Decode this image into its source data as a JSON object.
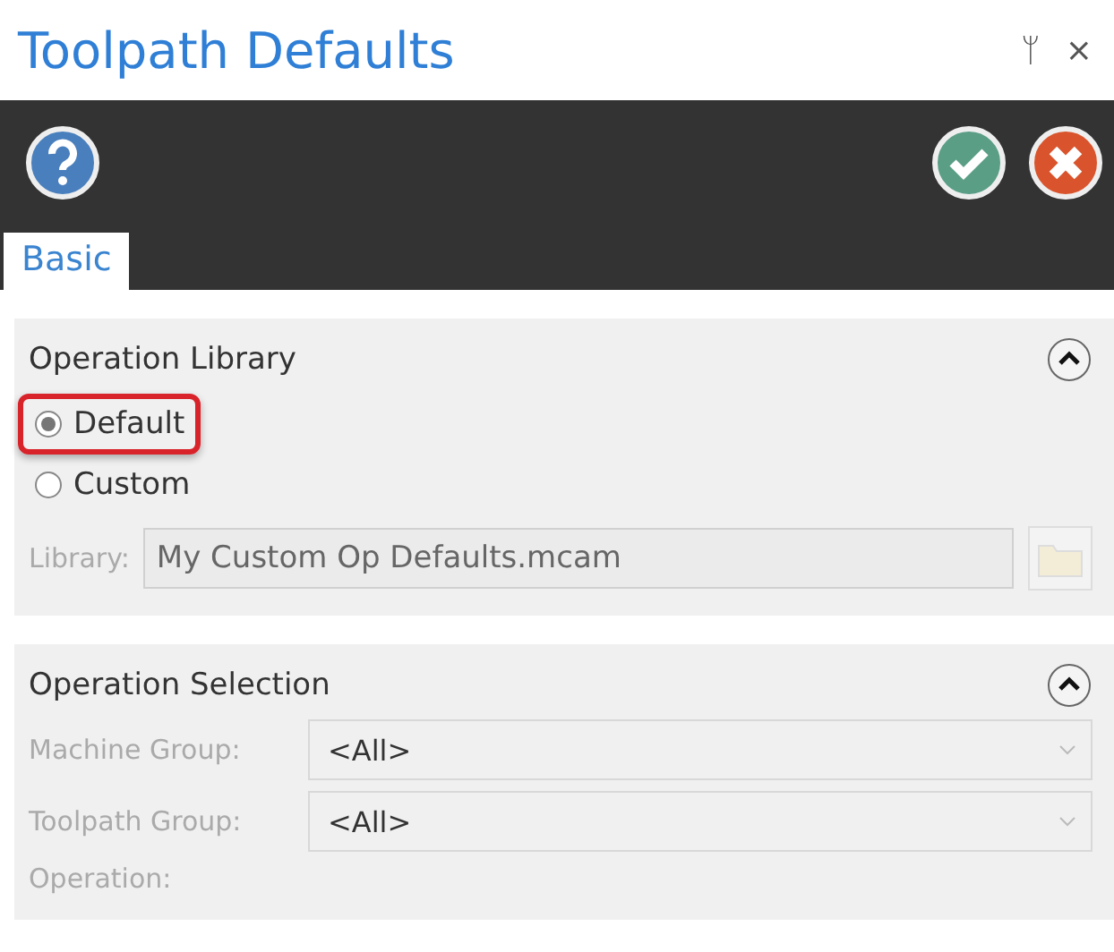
{
  "window": {
    "title": "Toolpath Defaults",
    "pin_glyph": "ᛘ",
    "close_glyph": "×"
  },
  "tabs": [
    {
      "label": "Basic",
      "selected": true
    }
  ],
  "sections": [
    {
      "title": "Operation Library",
      "expanded": true,
      "radios": [
        {
          "label": "Default",
          "selected": true,
          "highlighted": true
        },
        {
          "label": "Custom",
          "selected": false,
          "highlighted": false
        }
      ],
      "fields": [
        {
          "kind": "file",
          "label": "Library:",
          "value": "My Custom Op Defaults.mcam",
          "disabled": true
        }
      ]
    },
    {
      "title": "Operation Selection",
      "expanded": true,
      "fields": [
        {
          "kind": "dropdown",
          "label": "Machine Group:",
          "value": "<All>",
          "disabled": true
        },
        {
          "kind": "dropdown",
          "label": "Toolpath Group:",
          "value": "<All>",
          "disabled": true
        },
        {
          "kind": "label",
          "label": "Operation:",
          "disabled": true
        }
      ]
    }
  ]
}
